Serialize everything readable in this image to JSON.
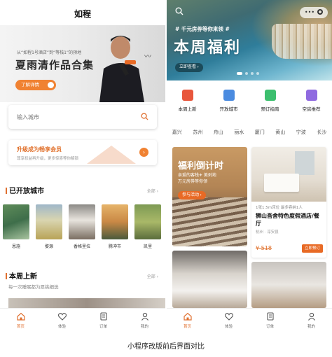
{
  "left": {
    "title": "如程",
    "banner": {
      "small_text": "从“如程1号酒店”到“等栈1”的预地",
      "headline": "夏雨清作品合集",
      "button_label": "了解详情"
    },
    "search": {
      "placeholder": "输入城市"
    },
    "member": {
      "title": "升级成为畅享会员",
      "subtitle": "尊享权益再升级，更多惊喜等你解锁"
    },
    "open_cities": {
      "heading": "已开放城市",
      "all_label": "全部 ›",
      "items": [
        {
          "name": "恩施"
        },
        {
          "name": "婺源"
        },
        {
          "name": "香格里拉"
        },
        {
          "name": "腾冲市"
        },
        {
          "name": "凯里"
        }
      ]
    },
    "weekly_new": {
      "heading": "本周上新",
      "all_label": "全部 ›",
      "subtitle": "每一次睡眠都为愿挑细选"
    },
    "tabs": [
      {
        "label": "首页",
        "icon": "home-icon"
      },
      {
        "label": "体验",
        "icon": "heart-icon"
      },
      {
        "label": "订单",
        "icon": "order-icon"
      },
      {
        "label": "我的",
        "icon": "user-icon"
      }
    ]
  },
  "right": {
    "banner": {
      "tag": "# 千元房券等你来领 #",
      "headline": "本周福利",
      "button_label": "立即查看 ›"
    },
    "quick": [
      {
        "label": "本周上新",
        "color": "#e8563c",
        "icon": "new-badge-icon"
      },
      {
        "label": "开放城市",
        "color": "#4a8be0",
        "icon": "building-icon"
      },
      {
        "label": "预订指南",
        "color": "#3cbf6e",
        "icon": "book-icon"
      },
      {
        "label": "空房推荐",
        "color": "#8f6ae0",
        "icon": "bed-icon"
      }
    ],
    "cities": [
      "嘉兴",
      "苏州",
      "舟山",
      "丽水",
      "厦门",
      "黄山",
      "宁波",
      "长沙"
    ],
    "countdown": {
      "title": "福利倒计时",
      "subtitle_1": "亲爱的客栈✈ 美剁地",
      "subtitle_2": "万元房券等你领",
      "button_label": "参与活动 ›"
    },
    "hotel": {
      "meta": "1张1.5m床位  最多容纳1人",
      "name": "狮山吾舍特色度假酒店/餐厅",
      "location": "杭州 · 淳安县",
      "price": "¥ 518",
      "book_label": "立即预订"
    },
    "tabs": [
      {
        "label": "首页",
        "icon": "home-icon"
      },
      {
        "label": "体验",
        "icon": "heart-icon"
      },
      {
        "label": "订单",
        "icon": "order-icon"
      },
      {
        "label": "我的",
        "icon": "user-icon"
      }
    ]
  },
  "caption": "小程序改版前后界面对比",
  "colors": {
    "accent": "#e8703a",
    "tab_active": "#e07030"
  }
}
